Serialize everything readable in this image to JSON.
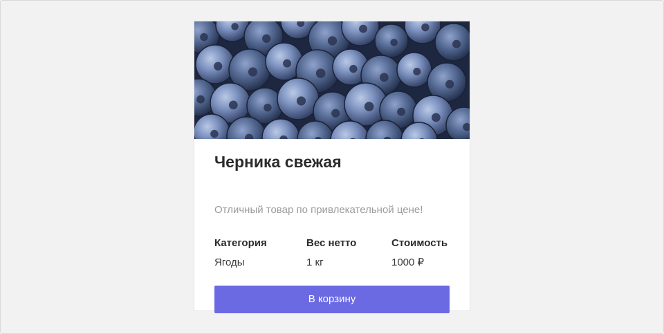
{
  "product": {
    "image_subject": "blueberries",
    "title": "Черника свежая",
    "description": "Отличный товар по привлекательной цене!",
    "specs": [
      {
        "label": "Категория",
        "value": "Ягоды"
      },
      {
        "label": "Вес нетто",
        "value": "1 кг"
      },
      {
        "label": "Стоимость",
        "value": "1000 ₽"
      }
    ],
    "cart_button_label": "В корзину"
  },
  "colors": {
    "page_background": "#f2f2f2",
    "card_background": "#ffffff",
    "button_accent": "#6b6ae2",
    "title_text": "#2b2b2b",
    "muted_text": "#9c9c9c"
  }
}
